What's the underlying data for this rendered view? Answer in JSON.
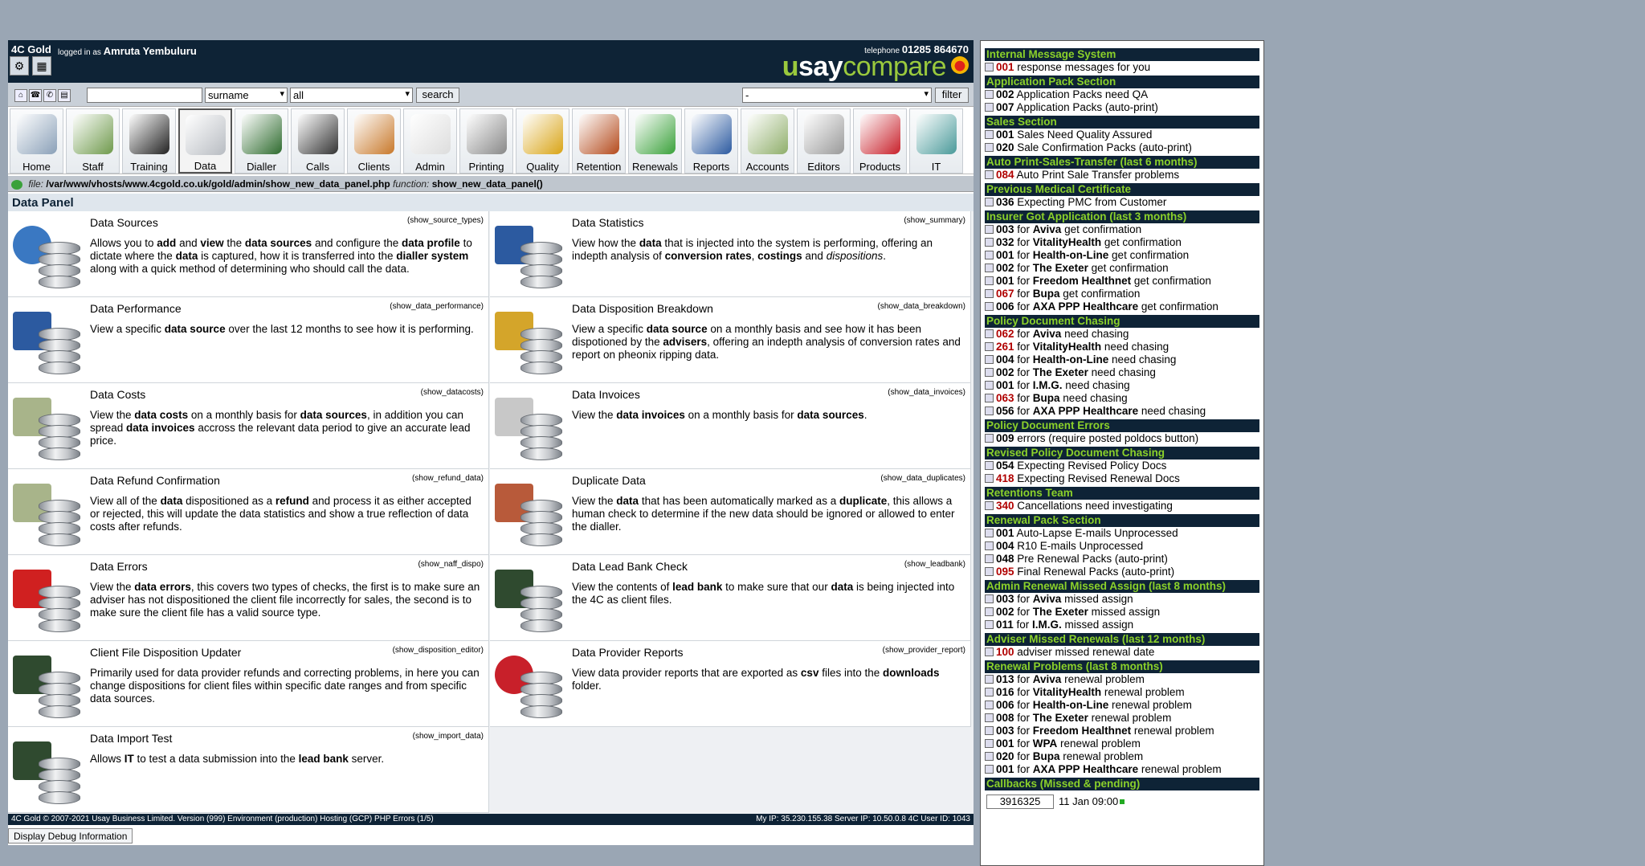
{
  "header": {
    "brand": "4C Gold",
    "logged_label": "logged in as",
    "user": "Amruta Yembuluru",
    "tel_label": "telephone",
    "tel_number": "01285 864670",
    "logo_u": "u",
    "logo_say": "say",
    "logo_compare": "compare"
  },
  "searchbar": {
    "field_select": "surname",
    "scope_select": "all",
    "search_label": "search",
    "filter_select": "-",
    "filter_label": "filter"
  },
  "nav": [
    {
      "label": "Home",
      "icon": "home-icon",
      "color": "#8aa0b8"
    },
    {
      "label": "Staff",
      "icon": "staff-icon",
      "color": "#6f9a4c"
    },
    {
      "label": "Training",
      "icon": "graduation-cap-icon",
      "color": "#222222"
    },
    {
      "label": "Data",
      "icon": "database-icon",
      "color": "#b8bcc2"
    },
    {
      "label": "Dialler",
      "icon": "dialler-icon",
      "color": "#2e6b2e"
    },
    {
      "label": "Calls",
      "icon": "phone-icon",
      "color": "#333333"
    },
    {
      "label": "Clients",
      "icon": "cabinet-icon",
      "color": "#c8782a"
    },
    {
      "label": "Admin",
      "icon": "document-icon",
      "color": "#dddddd"
    },
    {
      "label": "Printing",
      "icon": "printer-icon",
      "color": "#888888"
    },
    {
      "label": "Quality",
      "icon": "thumbs-up-icon",
      "color": "#d9a416"
    },
    {
      "label": "Retention",
      "icon": "retention-box-icon",
      "color": "#b44a1c"
    },
    {
      "label": "Renewals",
      "icon": "recycle-icon",
      "color": "#3aa13a"
    },
    {
      "label": "Reports",
      "icon": "bar-chart-icon",
      "color": "#2c5aa0"
    },
    {
      "label": "Accounts",
      "icon": "money-icon",
      "color": "#8fae6a"
    },
    {
      "label": "Editors",
      "icon": "gears-icon",
      "color": "#9a9a9a"
    },
    {
      "label": "Products",
      "icon": "target-icon",
      "color": "#c8202a"
    },
    {
      "label": "IT",
      "icon": "tools-icon",
      "color": "#4a9a9a"
    }
  ],
  "filebar": {
    "file_label": "file:",
    "path": "/var/www/vhosts/www.4cgold.co.uk/gold/admin/show_new_data_panel.php",
    "function_label": "function:",
    "function": "show_new_data_panel()"
  },
  "panel_title": "Data Panel",
  "cards": [
    {
      "title": "Data Sources",
      "fn": "(show_source_types)",
      "emblem": "globe-icon",
      "desc": [
        [
          "Allows you to ",
          false
        ],
        [
          "add",
          true
        ],
        [
          " and ",
          false
        ],
        [
          "view",
          true
        ],
        [
          " the ",
          false
        ],
        [
          "data sources",
          true
        ],
        [
          " and configure the ",
          false
        ],
        [
          "data profile",
          true
        ],
        [
          " to dictate where the ",
          false
        ],
        [
          "data",
          true
        ],
        [
          " is captured, how it is transferred into the ",
          false
        ],
        [
          "dialler system",
          true
        ],
        [
          " along with a quick method of determining who should call the data.",
          false
        ]
      ]
    },
    {
      "title": "Data Statistics",
      "fn": "(show_summary)",
      "emblem": "bar-chart-icon",
      "desc": [
        [
          "View how the ",
          false
        ],
        [
          "data",
          true
        ],
        [
          " that is injected into the system is performing, offering an indepth analysis of ",
          false
        ],
        [
          "conversion rates",
          true
        ],
        [
          ", ",
          false
        ],
        [
          "costings",
          true
        ],
        [
          " and ",
          false
        ],
        [
          "dispositions",
          false
        ],
        [
          ".",
          false
        ]
      ]
    },
    {
      "title": "Data Performance",
      "fn": "(show_data_performance)",
      "emblem": "bar-chart-icon",
      "desc": [
        [
          "View a specific ",
          false
        ],
        [
          "data source",
          true
        ],
        [
          " over the last 12 months to see how it is performing.",
          false
        ]
      ]
    },
    {
      "title": "Data Disposition Breakdown",
      "fn": "(show_data_breakdown)",
      "emblem": "magnifier-icon",
      "desc": [
        [
          "View a specific ",
          false
        ],
        [
          "data source",
          true
        ],
        [
          " on a monthly basis and see how it has been dispotioned by the ",
          false
        ],
        [
          "advisers",
          true
        ],
        [
          ", offering an indepth analysis of conversion rates and report on pheonix ripping data.",
          false
        ]
      ]
    },
    {
      "title": "Data Costs",
      "fn": "(show_datacosts)",
      "emblem": "coins-icon",
      "desc": [
        [
          "View the ",
          false
        ],
        [
          "data costs",
          true
        ],
        [
          " on a monthly basis for ",
          false
        ],
        [
          "data sources",
          true
        ],
        [
          ", in addition you can spread ",
          false
        ],
        [
          "data invoices",
          true
        ],
        [
          " accross the relevant data period to give an accurate lead price.",
          false
        ]
      ]
    },
    {
      "title": "Data Invoices",
      "fn": "(show_data_invoices)",
      "emblem": "calculator-icon",
      "desc": [
        [
          "View the ",
          false
        ],
        [
          "data invoices",
          true
        ],
        [
          " on a monthly basis for ",
          false
        ],
        [
          "data sources",
          true
        ],
        [
          ".",
          false
        ]
      ]
    },
    {
      "title": "Data Refund Confirmation",
      "fn": "(show_refund_data)",
      "emblem": "refund-icon",
      "desc": [
        [
          "View all of the ",
          false
        ],
        [
          "data",
          true
        ],
        [
          " dispositioned as a ",
          false
        ],
        [
          "refund",
          true
        ],
        [
          " and process it as either accepted or rejected, this will update the data statistics and show a true reflection of data costs after refunds.",
          false
        ]
      ]
    },
    {
      "title": "Duplicate Data",
      "fn": "(show_data_duplicates)",
      "emblem": "people-icon",
      "desc": [
        [
          "View the ",
          false
        ],
        [
          "data",
          true
        ],
        [
          " that has been automatically marked as a ",
          false
        ],
        [
          "duplicate",
          true
        ],
        [
          ", this allows a human check to determine if the new data should be ignored or allowed to enter the dialler.",
          false
        ]
      ]
    },
    {
      "title": "Data Errors",
      "fn": "(show_naff_dispo)",
      "emblem": "error-icon",
      "desc": [
        [
          "View the ",
          false
        ],
        [
          "data errors",
          true
        ],
        [
          ", this covers two types of checks, the first is to make sure an adviser has not dispositioned the client file incorrectly for sales, the second is to make sure the client file has a valid source type.",
          false
        ]
      ]
    },
    {
      "title": "Data Lead Bank Check",
      "fn": "(show_leadbank)",
      "emblem": "terminal-icon",
      "desc": [
        [
          "View the contents of ",
          false
        ],
        [
          "lead bank",
          true
        ],
        [
          " to make sure that our ",
          false
        ],
        [
          "data",
          true
        ],
        [
          " is being injected into the 4C as client files.",
          false
        ]
      ]
    },
    {
      "title": "Client File Disposition Updater",
      "fn": "(show_disposition_editor)",
      "emblem": "terminal-icon",
      "desc": [
        [
          "Primarily used for data provider refunds and correcting problems, in here you can change dispositions for client files within specific date ranges and from specific data sources.",
          false
        ]
      ]
    },
    {
      "title": "Data Provider Reports",
      "fn": "(show_provider_report)",
      "emblem": "target-icon",
      "desc": [
        [
          "View data provider reports that are exported as ",
          false
        ],
        [
          "csv",
          true
        ],
        [
          " files into the ",
          false
        ],
        [
          "downloads",
          true
        ],
        [
          " folder.",
          false
        ]
      ]
    },
    {
      "title": "Data Import Test",
      "fn": "(show_import_data)",
      "emblem": "terminal-icon",
      "desc": [
        [
          "Allows ",
          false
        ],
        [
          "IT",
          true
        ],
        [
          " to test a data submission into the ",
          false
        ],
        [
          "lead bank",
          true
        ],
        [
          " server.",
          false
        ]
      ]
    }
  ],
  "footer": {
    "left": "4C Gold © 2007-2021 Usay Business Limited. Version (999) Environment (production) Hosting (GCP) PHP Errors (1/5)",
    "right": "My IP: 35.230.155.38 Server IP: 10.50.0.8 4C User ID: 1043"
  },
  "debug_label": "Display Debug Information",
  "sidebar": [
    {
      "h": "Internal Message System",
      "items": [
        {
          "n": "001",
          "red": true,
          "t": "response messages for you"
        }
      ]
    },
    {
      "h": "Application Pack Section",
      "items": [
        {
          "n": "002",
          "t": "Application Packs need QA"
        },
        {
          "n": "007",
          "t": "Application Packs (auto-print)"
        }
      ]
    },
    {
      "h": "Sales Section",
      "items": [
        {
          "n": "001",
          "t": "Sales Need Quality Assured"
        },
        {
          "n": "020",
          "t": "Sale Confirmation Packs (auto-print)"
        }
      ]
    },
    {
      "h": "Auto Print-Sales-Transfer (last 6 months)",
      "items": [
        {
          "n": "084",
          "red": true,
          "t": "Auto Print Sale Transfer problems"
        }
      ]
    },
    {
      "h": "Previous Medical Certificate",
      "items": [
        {
          "n": "036",
          "t": "Expecting PMC from Customer"
        }
      ]
    },
    {
      "h": "Insurer Got Application (last 3 months)",
      "items": [
        {
          "n": "003",
          "pre": "for",
          "b": "Aviva",
          "t": "get confirmation"
        },
        {
          "n": "032",
          "pre": "for",
          "b": "VitalityHealth",
          "t": "get confirmation"
        },
        {
          "n": "001",
          "pre": "for",
          "b": "Health-on-Line",
          "t": "get confirmation"
        },
        {
          "n": "002",
          "pre": "for",
          "b": "The Exeter",
          "t": "get confirmation"
        },
        {
          "n": "001",
          "pre": "for",
          "b": "Freedom Healthnet",
          "t": "get confirmation"
        },
        {
          "n": "067",
          "red": true,
          "pre": "for",
          "b": "Bupa",
          "t": "get confirmation"
        },
        {
          "n": "006",
          "pre": "for",
          "b": "AXA PPP Healthcare",
          "t": "get confirmation"
        }
      ]
    },
    {
      "h": "Policy Document Chasing",
      "items": [
        {
          "n": "062",
          "red": true,
          "pre": "for",
          "b": "Aviva",
          "t": "need chasing"
        },
        {
          "n": "261",
          "red": true,
          "pre": "for",
          "b": "VitalityHealth",
          "t": "need chasing"
        },
        {
          "n": "004",
          "pre": "for",
          "b": "Health-on-Line",
          "t": "need chasing"
        },
        {
          "n": "002",
          "pre": "for",
          "b": "The Exeter",
          "t": "need chasing"
        },
        {
          "n": "001",
          "pre": "for",
          "b": "I.M.G.",
          "t": "need chasing"
        },
        {
          "n": "063",
          "red": true,
          "pre": "for",
          "b": "Bupa",
          "t": "need chasing"
        },
        {
          "n": "056",
          "pre": "for",
          "b": "AXA PPP Healthcare",
          "t": "need chasing"
        }
      ]
    },
    {
      "h": "Policy Document Errors",
      "items": [
        {
          "n": "009",
          "t": "errors (require posted poldocs button)"
        }
      ]
    },
    {
      "h": "Revised Policy Document Chasing",
      "items": [
        {
          "n": "054",
          "t": "Expecting Revised Policy Docs"
        },
        {
          "n": "418",
          "red": true,
          "t": "Expecting Revised Renewal Docs"
        }
      ]
    },
    {
      "h": "Retentions Team",
      "items": [
        {
          "n": "340",
          "red": true,
          "t": "Cancellations need investigating"
        }
      ]
    },
    {
      "h": "Renewal Pack Section",
      "items": [
        {
          "n": "001",
          "t": "Auto-Lapse E-mails Unprocessed"
        },
        {
          "n": "004",
          "t": "R10 E-mails Unprocessed"
        },
        {
          "n": "048",
          "t": "Pre Renewal Packs (auto-print)"
        },
        {
          "n": "095",
          "red": true,
          "t": "Final Renewal Packs (auto-print)"
        }
      ]
    },
    {
      "h": "Admin Renewal Missed Assign (last 8 months)",
      "items": [
        {
          "n": "003",
          "pre": "for",
          "b": "Aviva",
          "t": "missed assign"
        },
        {
          "n": "002",
          "pre": "for",
          "b": "The Exeter",
          "t": "missed assign"
        },
        {
          "n": "011",
          "pre": "for",
          "b": "I.M.G.",
          "t": "missed assign"
        }
      ]
    },
    {
      "h": "Adviser Missed Renewals (last 12 months)",
      "items": [
        {
          "n": "100",
          "red": true,
          "t": "adviser missed renewal date"
        }
      ]
    },
    {
      "h": "Renewal Problems (last 8 months)",
      "items": [
        {
          "n": "013",
          "pre": "for",
          "b": "Aviva",
          "t": "renewal problem"
        },
        {
          "n": "016",
          "pre": "for",
          "b": "VitalityHealth",
          "t": "renewal problem"
        },
        {
          "n": "006",
          "pre": "for",
          "b": "Health-on-Line",
          "t": "renewal problem"
        },
        {
          "n": "008",
          "pre": "for",
          "b": "The Exeter",
          "t": "renewal problem"
        },
        {
          "n": "003",
          "pre": "for",
          "b": "Freedom Healthnet",
          "t": "renewal problem"
        },
        {
          "n": "001",
          "pre": "for",
          "b": "WPA",
          "t": "renewal problem"
        },
        {
          "n": "020",
          "pre": "for",
          "b": "Bupa",
          "t": "renewal problem"
        },
        {
          "n": "001",
          "pre": "for",
          "b": "AXA PPP Healthcare",
          "t": "renewal problem"
        }
      ]
    },
    {
      "h": "Callbacks (Missed & pending)",
      "items": []
    }
  ],
  "callback": {
    "id": "3916325",
    "time": "11 Jan 09:00"
  }
}
